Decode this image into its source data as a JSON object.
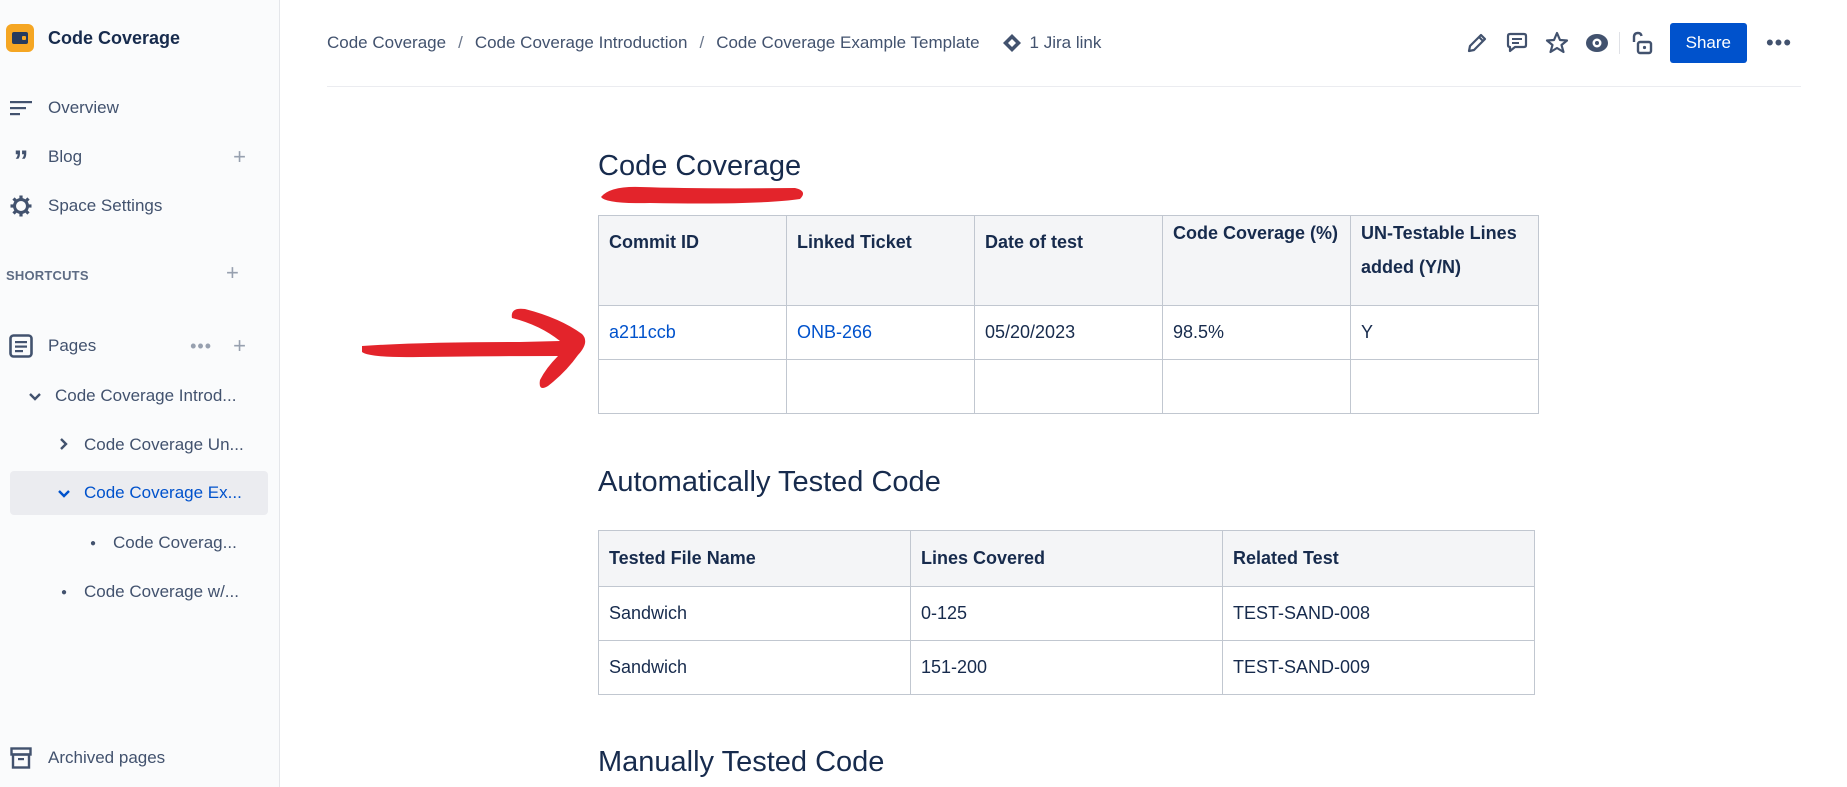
{
  "sidebar": {
    "space_title": "Code Coverage",
    "nav": [
      {
        "label": "Overview"
      },
      {
        "label": "Blog"
      },
      {
        "label": "Space Settings"
      }
    ],
    "shortcuts_label": "SHORTCUTS",
    "pages_label": "Pages",
    "tree": [
      {
        "label": "Code Coverage Introd..."
      },
      {
        "label": "Code Coverage Un..."
      },
      {
        "label": "Code Coverage Ex..."
      },
      {
        "label": "Code Coverag..."
      },
      {
        "label": "Code Coverage w/..."
      }
    ],
    "archived_label": "Archived pages"
  },
  "breadcrumbs": [
    "Code Coverage",
    "Code Coverage Introduction",
    "Code Coverage Example Template"
  ],
  "breadcrumb_separator": "/",
  "jira_link": "1 Jira link",
  "share_label": "Share",
  "page": {
    "title": "Code Coverage",
    "table1": {
      "headers": [
        "Commit ID",
        "Linked Ticket",
        "Date of test",
        "Code Coverage (%)",
        "UN-Testable Lines added (Y/N)"
      ],
      "rows": [
        [
          "a211ccb",
          "ONB-266",
          "05/20/2023",
          "98.5%",
          "Y"
        ],
        [
          "",
          "",
          "",
          "",
          ""
        ]
      ]
    },
    "section2_title": "Automatically Tested Code",
    "table2": {
      "headers": [
        "Tested File Name",
        "Lines Covered",
        "Related Test"
      ],
      "rows": [
        [
          "Sandwich",
          "0-125",
          "TEST-SAND-008"
        ],
        [
          "Sandwich",
          "151-200",
          "TEST-SAND-009"
        ]
      ]
    },
    "section3_title": "Manually Tested Code"
  },
  "colors": {
    "link": "#0052cc",
    "annotation_red": "#e3242b",
    "selected_bg": "#ebecf0",
    "share_bg": "#0052cc"
  }
}
